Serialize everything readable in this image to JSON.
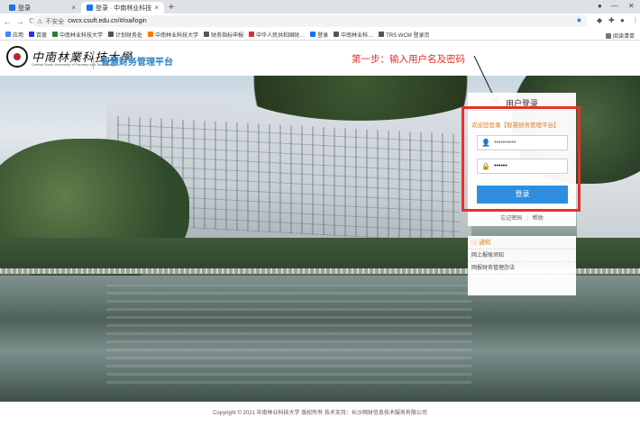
{
  "browser": {
    "tabs": [
      {
        "title": "登录",
        "active": false,
        "color": "#1a73e8"
      },
      {
        "title": "登录 · 中南林业科技大学 · 智慧",
        "active": true,
        "color": "#1a73e8"
      }
    ],
    "new_tab": "+",
    "address": {
      "security_label": "不安全",
      "url": "cwcx.csuft.edu.cn/#/oa/login"
    },
    "bookmarks": [
      {
        "label": "应用",
        "color": "#4285f4"
      },
      {
        "label": "百度",
        "color": "#2932e1"
      },
      {
        "label": "中南林业科技大学",
        "color": "#2e7d32"
      },
      {
        "label": "计划财务处",
        "color": "#555555"
      },
      {
        "label": "中南林业科技大学",
        "color": "#f57c00"
      },
      {
        "label": "财务指标申报",
        "color": "#555555"
      },
      {
        "label": "中华人民共和国财…",
        "color": "#d32f2f"
      },
      {
        "label": "登录",
        "color": "#1a73e8"
      },
      {
        "label": "中南林业科…",
        "color": "#555555"
      },
      {
        "label": "TRS WCM 登录页",
        "color": "#555555"
      }
    ],
    "reading_list": "阅读清单"
  },
  "header": {
    "logo_cn": "中南林業科技大學",
    "logo_en": "Central South University of Forestry and Technology",
    "system_name": "智慧财务管理平台",
    "step_note": "第一步：输入用户名及密码"
  },
  "login": {
    "title": "用户登录",
    "welcome": "欢迎您登录【智慧财务管理平台】",
    "username_value": "",
    "username_placeholder": "••••••••••",
    "password_value": "••••••",
    "submit_label": "登录",
    "forgot_label": "忘记密码",
    "help_label": "帮助"
  },
  "notice": {
    "title": "通知",
    "items": [
      "网上报账须知",
      "网报财务管理办法"
    ]
  },
  "footer": {
    "text": "Copyright © 2021 中南林业科技大学 版权所有  技术支持：长沙网财信息技术服务有限公司"
  },
  "colors": {
    "accent": "#2f8fde",
    "highlight": "#e5312b",
    "welcome": "#e07b1f"
  }
}
